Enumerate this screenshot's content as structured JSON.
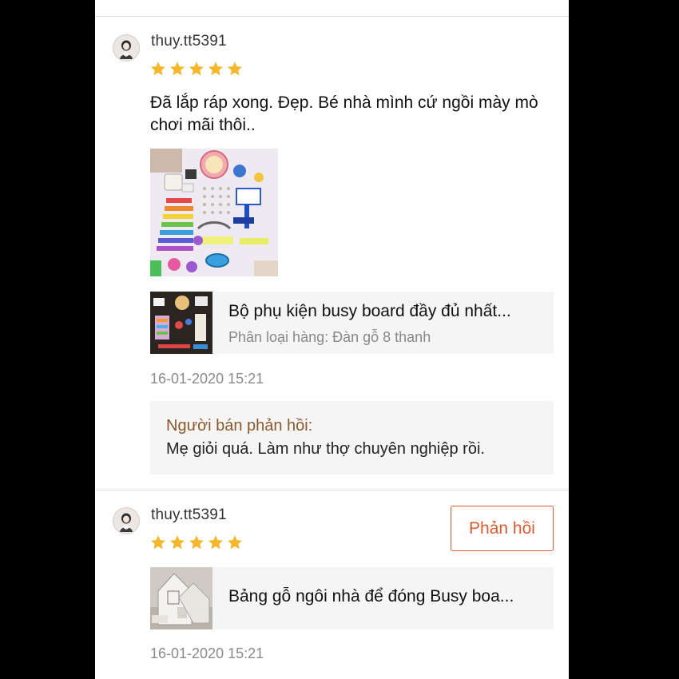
{
  "colors": {
    "star": "#f6b72a",
    "accent": "#e05a2f",
    "seller_label": "#8b5a2b"
  },
  "reviews": [
    {
      "username": "thuy.tt5391",
      "rating": 5,
      "comment": "Đã lắp ráp xong. Đẹp. Bé nhà mình cứ ngồi mày mò chơi mãi thôi..",
      "product_name": "Bộ phụ kiện busy board đầy đủ nhất...",
      "product_variant": "Phân loại hàng: Đàn gỗ 8 thanh",
      "date": "16-01-2020 15:21",
      "seller_reply_label": "Người bán phản hồi:",
      "seller_reply_text": "Mẹ giỏi quá. Làm như thợ chuyên nghiệp rồi."
    },
    {
      "username": "thuy.tt5391",
      "rating": 5,
      "reply_button": "Phản hồi",
      "product_name": "Bảng gỗ ngôi nhà để đóng Busy boa...",
      "date": "16-01-2020 15:21"
    }
  ]
}
